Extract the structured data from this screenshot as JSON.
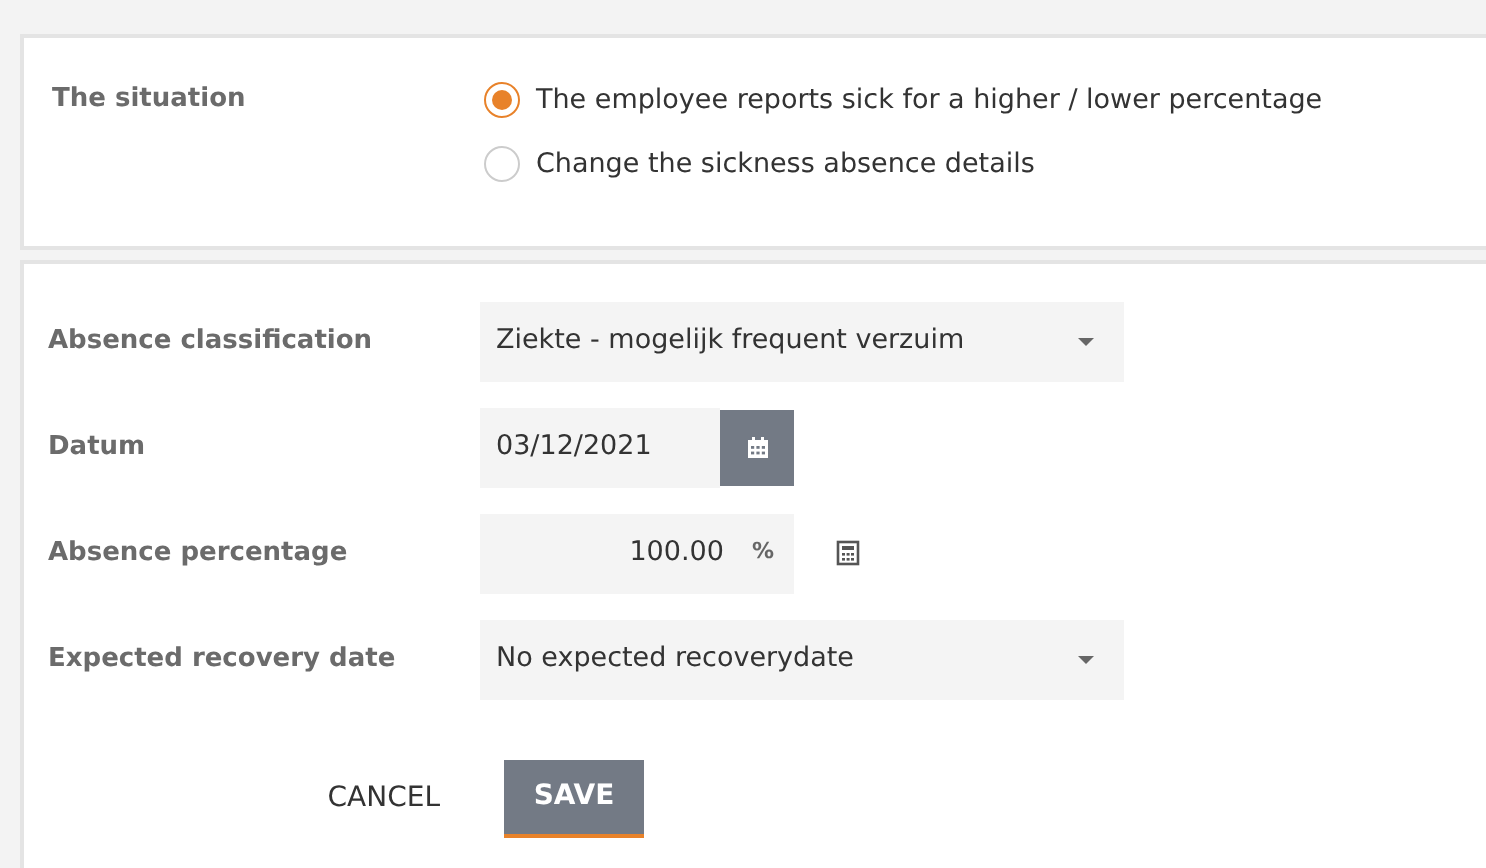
{
  "situation": {
    "label": "The situation",
    "options": [
      {
        "label": "The employee reports sick for a higher / lower percentage",
        "selected": true
      },
      {
        "label": "Change the sickness absence details",
        "selected": false
      }
    ]
  },
  "fields": [
    {
      "kind": "select",
      "label": "Absence classification",
      "value": "Ziekte - mogelijk frequent verzuim"
    },
    {
      "kind": "date",
      "label": "Datum",
      "value": "03/12/2021"
    },
    {
      "kind": "percent",
      "label": "Absence percentage",
      "value": "100.00",
      "unit": "%"
    },
    {
      "kind": "select",
      "label": "Expected recovery date",
      "value": "No expected recoverydate"
    }
  ],
  "buttons": {
    "cancel": "CANCEL",
    "save": "SAVE"
  }
}
